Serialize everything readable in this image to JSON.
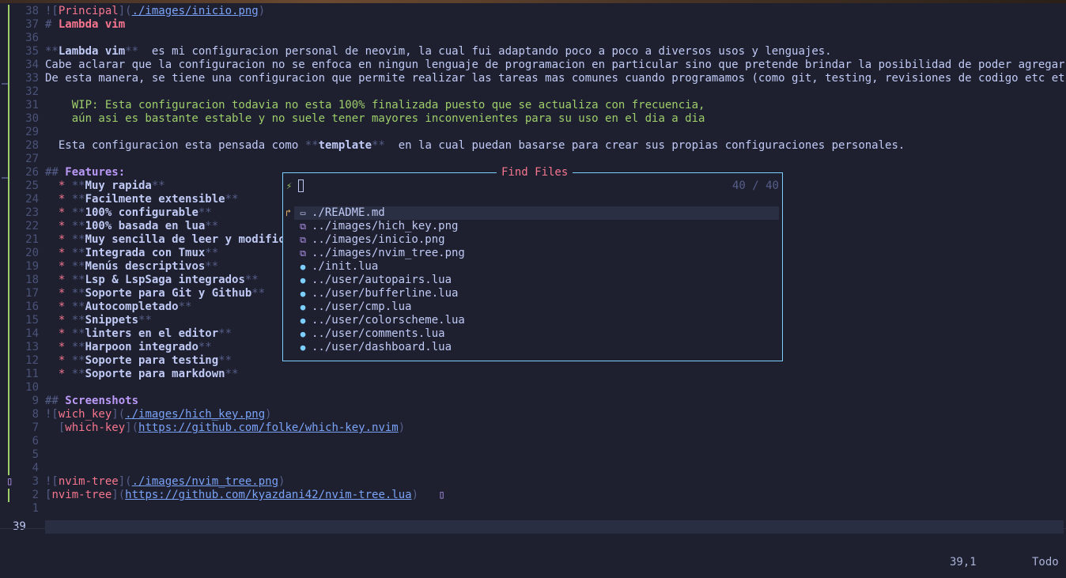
{
  "editor": {
    "lines": [
      {
        "num": "38",
        "parts": [
          [
            "d",
            "!["
          ],
          [
            "red",
            "Principal"
          ],
          [
            "d",
            "]("
          ],
          [
            "link",
            "./images/inicio.png"
          ],
          [
            "d",
            ")"
          ]
        ]
      },
      {
        "num": "37",
        "parts": [
          [
            "d",
            "# "
          ],
          [
            "redb",
            "Lambda vim"
          ]
        ]
      },
      {
        "num": "36",
        "parts": []
      },
      {
        "num": "35",
        "parts": [
          [
            "d",
            "**"
          ],
          [
            "bold",
            "Lambda vim"
          ],
          [
            "d",
            "**"
          ],
          [
            "",
            "  es mi configuracion personal de neovim, la cual fui adaptando poco a poco a diversos usos y lenguajes."
          ]
        ]
      },
      {
        "num": "34",
        "parts": [
          [
            "",
            "Cabe aclarar que la configuracion no se enfoca en ningun lenguaje de programacion en particular sino que pretende brindar la posibilidad de poder agregar nuevos"
          ]
        ]
      },
      {
        "num": "33",
        "parts": [
          [
            "",
            "De esta manera, se tiene una configuracion que permite realizar las tareas mas comunes cuando programamos (como git, testing, revisiones de codigo etc etc) indis"
          ]
        ]
      },
      {
        "num": "32",
        "parts": []
      },
      {
        "num": "31",
        "parts": [
          [
            "note",
            "    WIP: Esta configuracion todavia no esta 100% finalizada puesto que se actualiza con frecuencia,"
          ]
        ]
      },
      {
        "num": "30",
        "parts": [
          [
            "note",
            "    aún asi es bastante estable y no suele tener mayores inconvenientes para su uso en el dia a dia"
          ]
        ]
      },
      {
        "num": "29",
        "parts": []
      },
      {
        "num": "28",
        "parts": [
          [
            "",
            "  Esta configuracion esta pensada como "
          ],
          [
            "d",
            "**"
          ],
          [
            "bold",
            "template"
          ],
          [
            "d",
            "**"
          ],
          [
            "",
            "  en la cual puedan basarse para crear sus propias configuraciones personales."
          ]
        ]
      },
      {
        "num": "27",
        "parts": []
      },
      {
        "num": "26",
        "parts": [
          [
            "d",
            "## "
          ],
          [
            "pur",
            "Features:"
          ]
        ]
      },
      {
        "num": "25",
        "parts": [
          [
            "red",
            "  * "
          ],
          [
            "d",
            "**"
          ],
          [
            "bold",
            "Muy rapida"
          ],
          [
            "d",
            "**"
          ]
        ]
      },
      {
        "num": "24",
        "parts": [
          [
            "red",
            "  * "
          ],
          [
            "d",
            "**"
          ],
          [
            "bold",
            "Facilmente extensible"
          ],
          [
            "d",
            "**"
          ]
        ]
      },
      {
        "num": "23",
        "parts": [
          [
            "red",
            "  * "
          ],
          [
            "d",
            "**"
          ],
          [
            "bold",
            "100% configurable"
          ],
          [
            "d",
            "**"
          ]
        ]
      },
      {
        "num": "22",
        "parts": [
          [
            "red",
            "  * "
          ],
          [
            "d",
            "**"
          ],
          [
            "bold",
            "100% basada en lua"
          ],
          [
            "d",
            "**"
          ]
        ]
      },
      {
        "num": "21",
        "parts": [
          [
            "red",
            "  * "
          ],
          [
            "d",
            "**"
          ],
          [
            "bold",
            "Muy sencilla de leer y modifica"
          ]
        ]
      },
      {
        "num": "20",
        "parts": [
          [
            "red",
            "  * "
          ],
          [
            "d",
            "**"
          ],
          [
            "bold",
            "Integrada con Tmux"
          ],
          [
            "d",
            "**"
          ]
        ]
      },
      {
        "num": "19",
        "parts": [
          [
            "red",
            "  * "
          ],
          [
            "d",
            "**"
          ],
          [
            "bold",
            "Menús descriptivos"
          ],
          [
            "d",
            "**"
          ]
        ]
      },
      {
        "num": "18",
        "parts": [
          [
            "red",
            "  * "
          ],
          [
            "d",
            "**"
          ],
          [
            "bold",
            "Lsp & LspSaga integrados"
          ],
          [
            "d",
            "**"
          ]
        ]
      },
      {
        "num": "17",
        "parts": [
          [
            "red",
            "  * "
          ],
          [
            "d",
            "**"
          ],
          [
            "bold",
            "Soporte para Git y Github"
          ],
          [
            "d",
            "**"
          ]
        ]
      },
      {
        "num": "16",
        "parts": [
          [
            "red",
            "  * "
          ],
          [
            "d",
            "**"
          ],
          [
            "bold",
            "Autocompletado"
          ],
          [
            "d",
            "**"
          ]
        ]
      },
      {
        "num": "15",
        "parts": [
          [
            "red",
            "  * "
          ],
          [
            "d",
            "**"
          ],
          [
            "bold",
            "Snippets"
          ],
          [
            "d",
            "**"
          ]
        ]
      },
      {
        "num": "14",
        "parts": [
          [
            "red",
            "  * "
          ],
          [
            "d",
            "**"
          ],
          [
            "bold",
            "linters en el editor"
          ],
          [
            "d",
            "**"
          ]
        ]
      },
      {
        "num": "13",
        "parts": [
          [
            "red",
            "  * "
          ],
          [
            "d",
            "**"
          ],
          [
            "bold",
            "Harpoon integrado"
          ],
          [
            "d",
            "**"
          ]
        ]
      },
      {
        "num": "12",
        "parts": [
          [
            "red",
            "  * "
          ],
          [
            "d",
            "**"
          ],
          [
            "bold",
            "Soporte para testing"
          ],
          [
            "d",
            "**"
          ]
        ]
      },
      {
        "num": "11",
        "parts": [
          [
            "red",
            "  * "
          ],
          [
            "d",
            "**"
          ],
          [
            "bold",
            "Soporte para markdown"
          ],
          [
            "d",
            "**"
          ]
        ]
      },
      {
        "num": "10",
        "parts": []
      },
      {
        "num": "9",
        "parts": [
          [
            "d",
            "## "
          ],
          [
            "pur",
            "Screenshots"
          ]
        ]
      },
      {
        "num": "8",
        "parts": [
          [
            "d",
            "!["
          ],
          [
            "red",
            "wich_key"
          ],
          [
            "d",
            "]("
          ],
          [
            "link",
            "./images/hich_key.png"
          ],
          [
            "d",
            ")"
          ]
        ]
      },
      {
        "num": "7",
        "parts": [
          [
            "d",
            "  ["
          ],
          [
            "red",
            "which-key"
          ],
          [
            "d",
            "]("
          ],
          [
            "link",
            "https://github.com/folke/which-key.nvim"
          ],
          [
            "d",
            ")"
          ]
        ]
      },
      {
        "num": "6",
        "parts": []
      },
      {
        "num": "5",
        "parts": []
      },
      {
        "num": "4",
        "parts": []
      },
      {
        "num": "3",
        "parts": [
          [
            "d",
            "!["
          ],
          [
            "red",
            "nvim-tree"
          ],
          [
            "d",
            "]("
          ],
          [
            "link",
            "./images/nvim_tree.png"
          ],
          [
            "d",
            ")"
          ]
        ]
      },
      {
        "num": "2",
        "parts": [
          [
            "d",
            "["
          ],
          [
            "red",
            "nvim-tree"
          ],
          [
            "d",
            "]("
          ],
          [
            "link",
            "https://github.com/kyazdani42/nvim-tree.lua"
          ],
          [
            "d",
            ")"
          ],
          [
            "",
            "   "
          ],
          [
            "box",
            "▯"
          ]
        ]
      },
      {
        "num": "1",
        "parts": []
      },
      {
        "num": "39",
        "parts": [],
        "current": true
      }
    ]
  },
  "finder": {
    "title": "Find Files",
    "counter": "40 / 40",
    "prompt_icon": "prompt-icon",
    "results": [
      {
        "name": "./README.md",
        "icon": "markdown-file-icon",
        "glyph": "▭",
        "cls": "ic-md",
        "selected": true
      },
      {
        "name": "../images/hich_key.png",
        "icon": "image-file-icon",
        "glyph": "⧉",
        "cls": "ic-png"
      },
      {
        "name": "../images/inicio.png",
        "icon": "image-file-icon",
        "glyph": "⧉",
        "cls": "ic-png"
      },
      {
        "name": "../images/nvim_tree.png",
        "icon": "image-file-icon",
        "glyph": "⧉",
        "cls": "ic-png"
      },
      {
        "name": "./init.lua",
        "icon": "lua-file-icon",
        "glyph": "●",
        "cls": "ic-lua"
      },
      {
        "name": "../user/autopairs.lua",
        "icon": "lua-file-icon",
        "glyph": "●",
        "cls": "ic-lua"
      },
      {
        "name": "../user/bufferline.lua",
        "icon": "lua-file-icon",
        "glyph": "●",
        "cls": "ic-lua"
      },
      {
        "name": "../user/cmp.lua",
        "icon": "lua-file-icon",
        "glyph": "●",
        "cls": "ic-lua"
      },
      {
        "name": "../user/colorscheme.lua",
        "icon": "lua-file-icon",
        "glyph": "●",
        "cls": "ic-lua"
      },
      {
        "name": "../user/comments.lua",
        "icon": "lua-file-icon",
        "glyph": "●",
        "cls": "ic-lua"
      },
      {
        "name": "../user/dashboard.lua",
        "icon": "lua-file-icon",
        "glyph": "●",
        "cls": "ic-lua"
      }
    ]
  },
  "statusline": {
    "position": "39,1",
    "scroll": "Todo"
  },
  "colors": {
    "background": "#1e2030",
    "git_added": "#9ece6a",
    "git_changed": "#e0af68",
    "popup_border": "#7dcfff"
  }
}
